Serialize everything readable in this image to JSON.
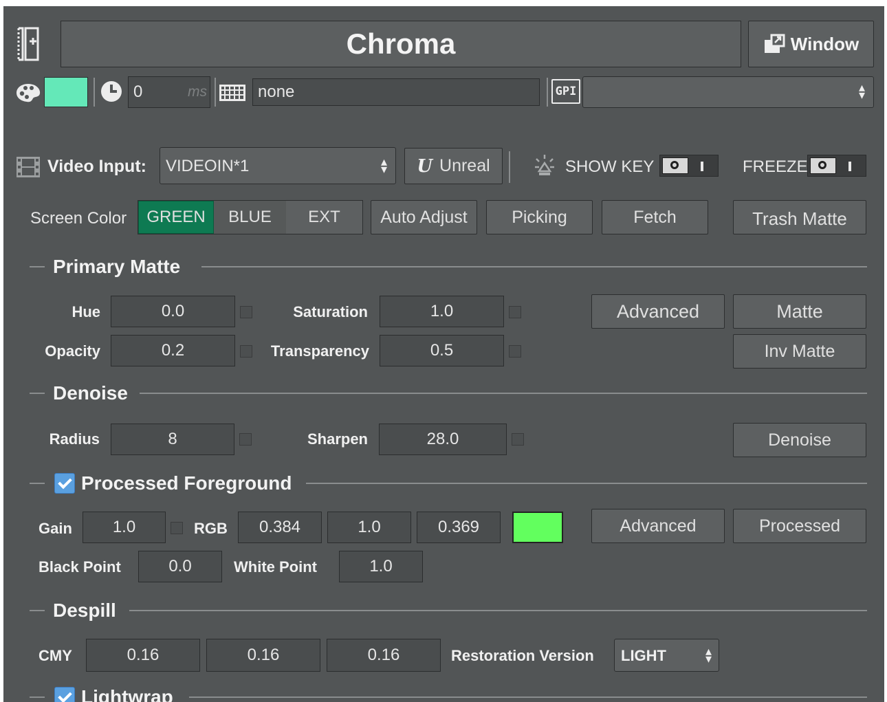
{
  "header": {
    "title": "Chroma",
    "window_button": "Window",
    "color_swatch": "#64e8b8",
    "delay_value": "0",
    "delay_unit": "ms",
    "keyboard_value": "none",
    "gpi_label": "GPI",
    "gpi_select_value": ""
  },
  "input_row": {
    "video_input_label": "Video Input:",
    "video_input_value": "VIDEOIN*1",
    "unreal_button": "Unreal",
    "show_key_label": "SHOW KEY",
    "freeze_label": "FREEZE"
  },
  "screen_color": {
    "label": "Screen Color",
    "options": [
      "GREEN",
      "BLUE",
      "EXT"
    ],
    "selected": "GREEN",
    "auto_adjust": "Auto Adjust",
    "picking": "Picking",
    "fetch": "Fetch",
    "trash_matte": "Trash Matte"
  },
  "primary_matte": {
    "title": "Primary Matte",
    "hue_label": "Hue",
    "hue_value": "0.0",
    "saturation_label": "Saturation",
    "saturation_value": "1.0",
    "opacity_label": "Opacity",
    "opacity_value": "0.2",
    "transparency_label": "Transparency",
    "transparency_value": "0.5",
    "advanced_button": "Advanced",
    "matte_button": "Matte",
    "inv_matte_button": "Inv Matte"
  },
  "denoise": {
    "title": "Denoise",
    "radius_label": "Radius",
    "radius_value": "8",
    "sharpen_label": "Sharpen",
    "sharpen_value": "28.0",
    "denoise_button": "Denoise"
  },
  "processed_foreground": {
    "title": "Processed Foreground",
    "enabled": true,
    "gain_label": "Gain",
    "gain_value": "1.0",
    "rgb_label": "RGB",
    "r_value": "0.384",
    "g_value": "1.0",
    "b_value": "0.369",
    "swatch_color": "#62ff5e",
    "advanced_button": "Advanced",
    "processed_button": "Processed",
    "black_point_label": "Black Point",
    "black_point_value": "0.0",
    "white_point_label": "White Point",
    "white_point_value": "1.0"
  },
  "despill": {
    "title": "Despill",
    "cmy_label": "CMY",
    "c_value": "0.16",
    "m_value": "0.16",
    "y_value": "0.16",
    "restoration_label": "Restoration Version",
    "restoration_value": "LIGHT"
  },
  "lightwrap": {
    "title": "Lightwrap",
    "enabled": true
  },
  "colors": {
    "panel_bg": "#525556",
    "selected_segment": "#0e7a52",
    "checkbox_blue": "#5aa0e0"
  }
}
